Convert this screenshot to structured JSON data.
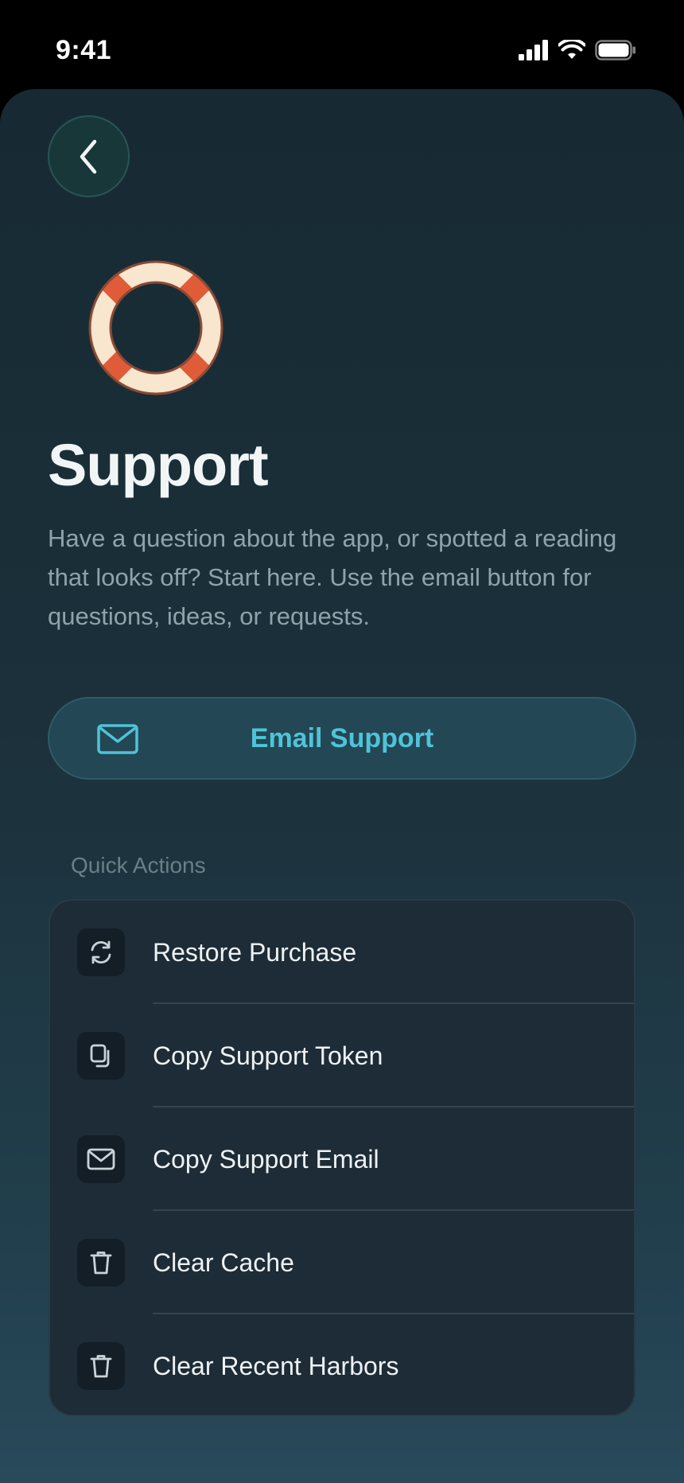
{
  "status_bar": {
    "time": "9:41",
    "icons": [
      "signal-icon",
      "wifi-icon",
      "battery-icon"
    ]
  },
  "header": {
    "back_icon": "chevron-left-icon"
  },
  "hero": {
    "icon": "life-ring-icon",
    "title": "Support",
    "description": "Have a question about the app, or spotted a reading that looks off? Start here. Use the email button for questions, ideas, or requests."
  },
  "email_button": {
    "label": "Email Support",
    "icon": "mail-icon"
  },
  "quick_actions": {
    "section_label": "Quick Actions",
    "items": [
      {
        "label": "Restore Purchase",
        "icon": "refresh-icon"
      },
      {
        "label": "Copy Support Token",
        "icon": "copy-icon"
      },
      {
        "label": "Copy Support Email",
        "icon": "mail-icon"
      },
      {
        "label": "Clear Cache",
        "icon": "trash-icon"
      },
      {
        "label": "Clear Recent Harbors",
        "icon": "trash-icon"
      }
    ]
  },
  "colors": {
    "accent": "#4fc3d9",
    "ring_orange": "#e05c38",
    "ring_cream": "#f8e6cf",
    "background": "#1b303a"
  }
}
